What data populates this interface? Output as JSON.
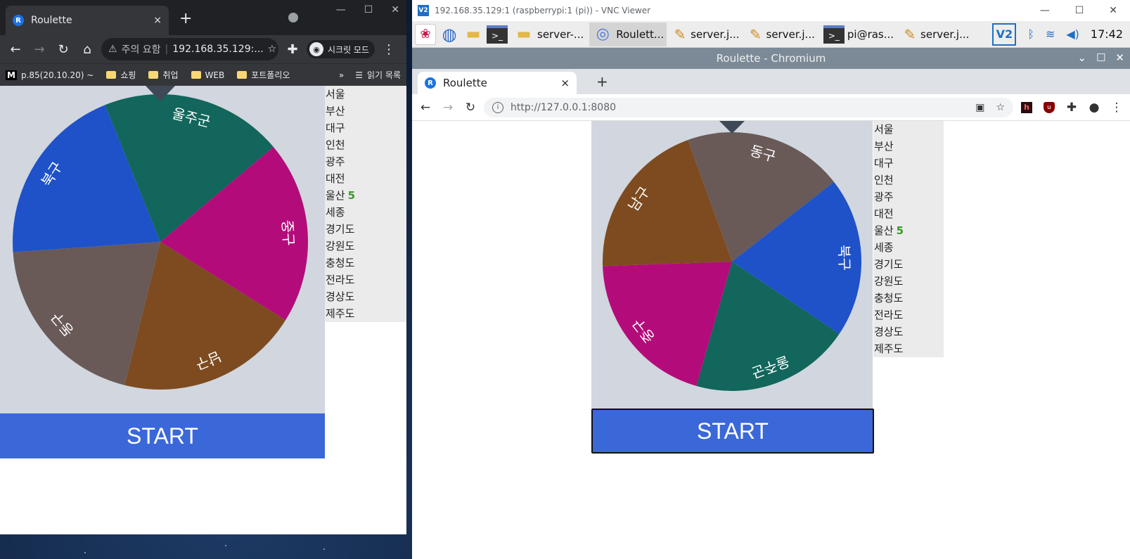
{
  "left_browser": {
    "tab_title": "Roulette",
    "tab_close": "×",
    "new_tab": "+",
    "security_warning": "주의 요함",
    "url": "192.168.35.129:...",
    "incognito_label": "시크릿 모드",
    "bookmarks": [
      {
        "label": "p.85(20.10.20) ~",
        "type": "m"
      },
      {
        "label": "쇼핑",
        "type": "folder"
      },
      {
        "label": "취업",
        "type": "folder"
      },
      {
        "label": "WEB",
        "type": "folder"
      },
      {
        "label": "포트폴리오",
        "type": "folder"
      }
    ],
    "bookmark_more": "»",
    "reading_list": "읽기 목록"
  },
  "vnc": {
    "window_title": "192.168.35.129:1 (raspberrypi:1 (pi)) - VNC Viewer",
    "taskbar": {
      "tasks": [
        "server-...",
        "Roulett...",
        "server.j...",
        "server.j...",
        "pi@ras...",
        "server.j..."
      ],
      "clock": "17:42"
    },
    "chromium_title": "Roulette - Chromium",
    "tab_title": "Roulette",
    "tab_close": "×",
    "new_tab": "+",
    "url": "http://127.0.0.1:8080"
  },
  "roulette": {
    "start_label": "START",
    "regions": [
      {
        "name": "서울"
      },
      {
        "name": "부산"
      },
      {
        "name": "대구"
      },
      {
        "name": "인천"
      },
      {
        "name": "광주"
      },
      {
        "name": "대전"
      },
      {
        "name": "울산",
        "count": "5"
      },
      {
        "name": "세종"
      },
      {
        "name": "경기도"
      },
      {
        "name": "강원도"
      },
      {
        "name": "충청도"
      },
      {
        "name": "전라도"
      },
      {
        "name": "경상도"
      },
      {
        "name": "제주도"
      }
    ],
    "segments": [
      {
        "label": "북구",
        "color": "#1f52c8"
      },
      {
        "label": "울주군",
        "color": "#12665c"
      },
      {
        "label": "중구",
        "color": "#b30c7a"
      },
      {
        "label": "남구",
        "color": "#7d4b1f"
      },
      {
        "label": "동구",
        "color": "#695a58"
      }
    ],
    "pointer_color": "#3f4856"
  }
}
